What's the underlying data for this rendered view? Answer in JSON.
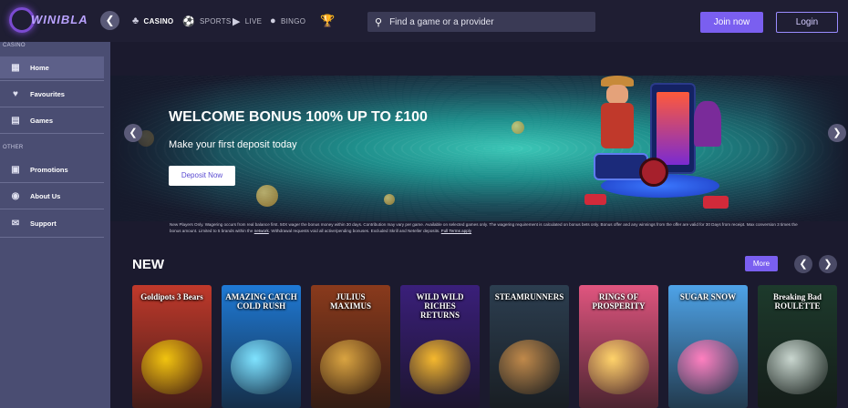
{
  "brand": {
    "name": "WINIBLA"
  },
  "nav": {
    "tabs": [
      {
        "label": "CASINO",
        "icon": "spade-icon"
      },
      {
        "label": "SPORTS",
        "icon": "ball-icon"
      },
      {
        "label": "LIVE",
        "icon": "live-icon"
      },
      {
        "label": "BINGO",
        "icon": "bingo-icon"
      }
    ],
    "trophy_icon": "trophy-icon"
  },
  "search": {
    "placeholder": "Find a game or a provider"
  },
  "auth": {
    "join_label": "Join now",
    "login_label": "Login"
  },
  "sidebar": {
    "casino_section": "CASINO",
    "other_section": "OTHER",
    "items": [
      {
        "label": "Home",
        "icon": "grid-icon",
        "active": true
      },
      {
        "label": "Favourites",
        "icon": "heart-icon"
      },
      {
        "label": "Games",
        "icon": "slot-machine-icon"
      },
      {
        "label": "Promotions",
        "icon": "gift-icon"
      },
      {
        "label": "About Us",
        "icon": "target-icon"
      },
      {
        "label": "Support",
        "icon": "chat-icon"
      }
    ]
  },
  "banner": {
    "title": "WELCOME BONUS 100% UP TO £100",
    "subtitle": "Make your first deposit today",
    "cta_label": "Deposit Now",
    "terms_text": "New Players Only. Wagering occurs from real balance first. 50X wager the bonus money within 30 days. Contribution may vary per game. Available on selected games only. The wagering requirement is calculated on bonus bets only. Bonus offer and any winnings from the offer are valid for 30 Days from receipt. Max conversion 3 times the bonus amount. Limited to 5 brands within the",
    "terms_link1": "network",
    "terms_text2": ". Withdrawal requests void all active/pending bonuses. Excluded Skrill and Neteller deposits.",
    "terms_link2": "Full Terms apply"
  },
  "new_section": {
    "title": "NEW",
    "more_label": "More",
    "games": [
      {
        "title": "Goldipots 3 Bears",
        "bg": "#c0392b",
        "accent": "#f1c40f"
      },
      {
        "title": "AMAZING CATCH COLD RUSH",
        "bg": "#1f7ad6",
        "accent": "#7fe3ff"
      },
      {
        "title": "JULIUS MAXIMUS",
        "bg": "#8a3a1c",
        "accent": "#d9a441"
      },
      {
        "title": "WILD WILD RICHES RETURNS",
        "bg": "#3a1f7a",
        "accent": "#f5b82e"
      },
      {
        "title": "STEAMRUNNERS",
        "bg": "#2c3e50",
        "accent": "#c0894a"
      },
      {
        "title": "RINGS OF PROSPERITY",
        "bg": "#e0557f",
        "accent": "#ffd36a"
      },
      {
        "title": "SUGAR SNOW",
        "bg": "#4ea3e8",
        "accent": "#ff7fbf"
      },
      {
        "title": "Breaking Bad ROULETTE",
        "bg": "#1d3a2c",
        "accent": "#c9d6cf"
      }
    ]
  }
}
